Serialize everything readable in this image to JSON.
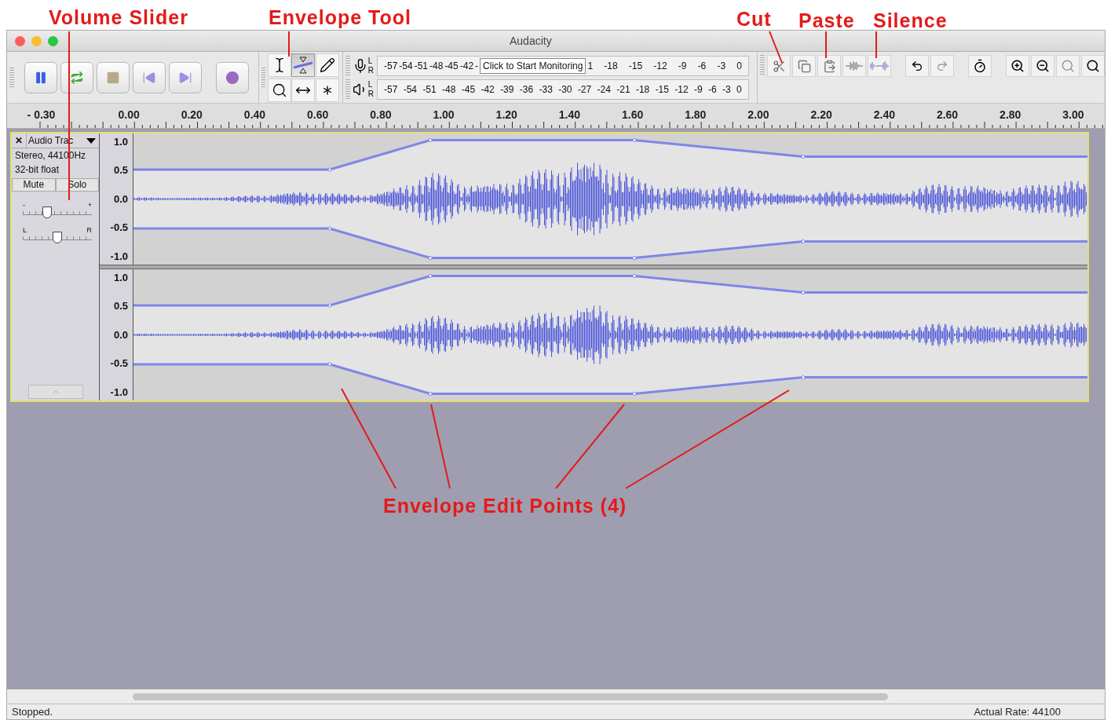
{
  "annotations": [
    {
      "text": "Volume Slider"
    },
    {
      "text": "Envelope Tool"
    },
    {
      "text": "Cut"
    },
    {
      "text": "Paste"
    },
    {
      "text": "Silence"
    },
    {
      "text": "Envelope Edit Points (4)"
    }
  ],
  "window": {
    "title": "Audacity"
  },
  "tools": [
    {
      "kind": "select",
      "selected": false
    },
    {
      "kind": "envelope",
      "selected": true
    },
    {
      "kind": "draw",
      "selected": false
    },
    {
      "kind": "zoom",
      "selected": false
    },
    {
      "kind": "timeshift",
      "selected": false
    },
    {
      "kind": "multi",
      "selected": false
    }
  ],
  "meters": [
    {
      "kind": "record",
      "left": "L",
      "right": "R",
      "ticks_before": [
        "-57",
        "-54",
        "-51",
        "-48",
        "-45",
        "-42",
        "-"
      ],
      "tooltip": "Click to Start Monitoring",
      "ticks_after": [
        "1",
        "-18",
        "-15",
        "-12",
        "-9",
        "-6",
        "-3",
        "0"
      ]
    },
    {
      "kind": "playback",
      "left": "L",
      "right": "R",
      "ticks_before": [
        "-57",
        "-54",
        "-51",
        "-48",
        "-45",
        "-42",
        "-39",
        "-36",
        "-33",
        "-30",
        "-27",
        "-24",
        "-21",
        "-18",
        "-15",
        "-12",
        "-9",
        "-6",
        "-3",
        "0"
      ]
    }
  ],
  "ruler": [
    "- 0.30",
    "0.00",
    "0.20",
    "0.40",
    "0.60",
    "0.80",
    "1.00",
    "1.20",
    "1.40",
    "1.60",
    "1.80",
    "2.00",
    "2.20",
    "2.40",
    "2.60",
    "2.80",
    "3.00"
  ],
  "track": {
    "close": "✕",
    "name": "Audio Trac",
    "info": [
      "Stereo, 44100Hz",
      "32-bit float"
    ],
    "buttons": [
      "Mute",
      "Solo"
    ],
    "gain": {
      "minus": "-",
      "plus": "+",
      "level": 0.35
    },
    "pan": {
      "left": "L",
      "right": "R",
      "level": 0.5
    },
    "channels": [
      {
        "scale": [
          "1.0",
          "0.5",
          "0.0",
          "-0.5",
          "-1.0"
        ]
      },
      {
        "scale": [
          "1.0",
          "0.5",
          "0.0",
          "-0.5",
          "-1.0"
        ]
      }
    ]
  },
  "status": {
    "left": "Stopped.",
    "right": "Actual Rate: 44100"
  }
}
